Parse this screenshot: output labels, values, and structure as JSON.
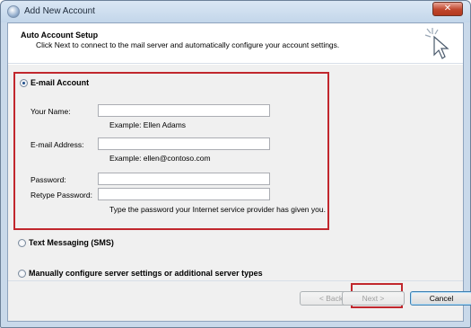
{
  "window": {
    "title": "Add New Account",
    "close_label": "✕",
    "colors": {
      "highlight_border": "#c1272d",
      "title_bg": "#c9d9ea"
    }
  },
  "header": {
    "title": "Auto Account Setup",
    "subtitle": "Click Next to connect to the mail server and automatically configure your account settings."
  },
  "email_account": {
    "option_label": "E-mail Account",
    "selected": true,
    "your_name": {
      "label": "Your Name:",
      "value": "",
      "hint": "Example: Ellen Adams"
    },
    "email_address": {
      "label": "E-mail Address:",
      "value": "",
      "hint": "Example: ellen@contoso.com"
    },
    "password": {
      "label": "Password:",
      "value": ""
    },
    "retype_password": {
      "label": "Retype Password:",
      "value": ""
    },
    "password_hint": "Type the password your Internet service provider has given you."
  },
  "text_messaging": {
    "option_label": "Text Messaging (SMS)",
    "selected": false
  },
  "manual_config": {
    "option_label": "Manually configure server settings or additional server types",
    "selected": false
  },
  "footer": {
    "back_label": "< Back",
    "next_label": "Next >",
    "cancel_label": "Cancel"
  },
  "icons": {
    "wizard": "cursor-click-icon",
    "app": "app-icon",
    "close": "close-icon"
  }
}
